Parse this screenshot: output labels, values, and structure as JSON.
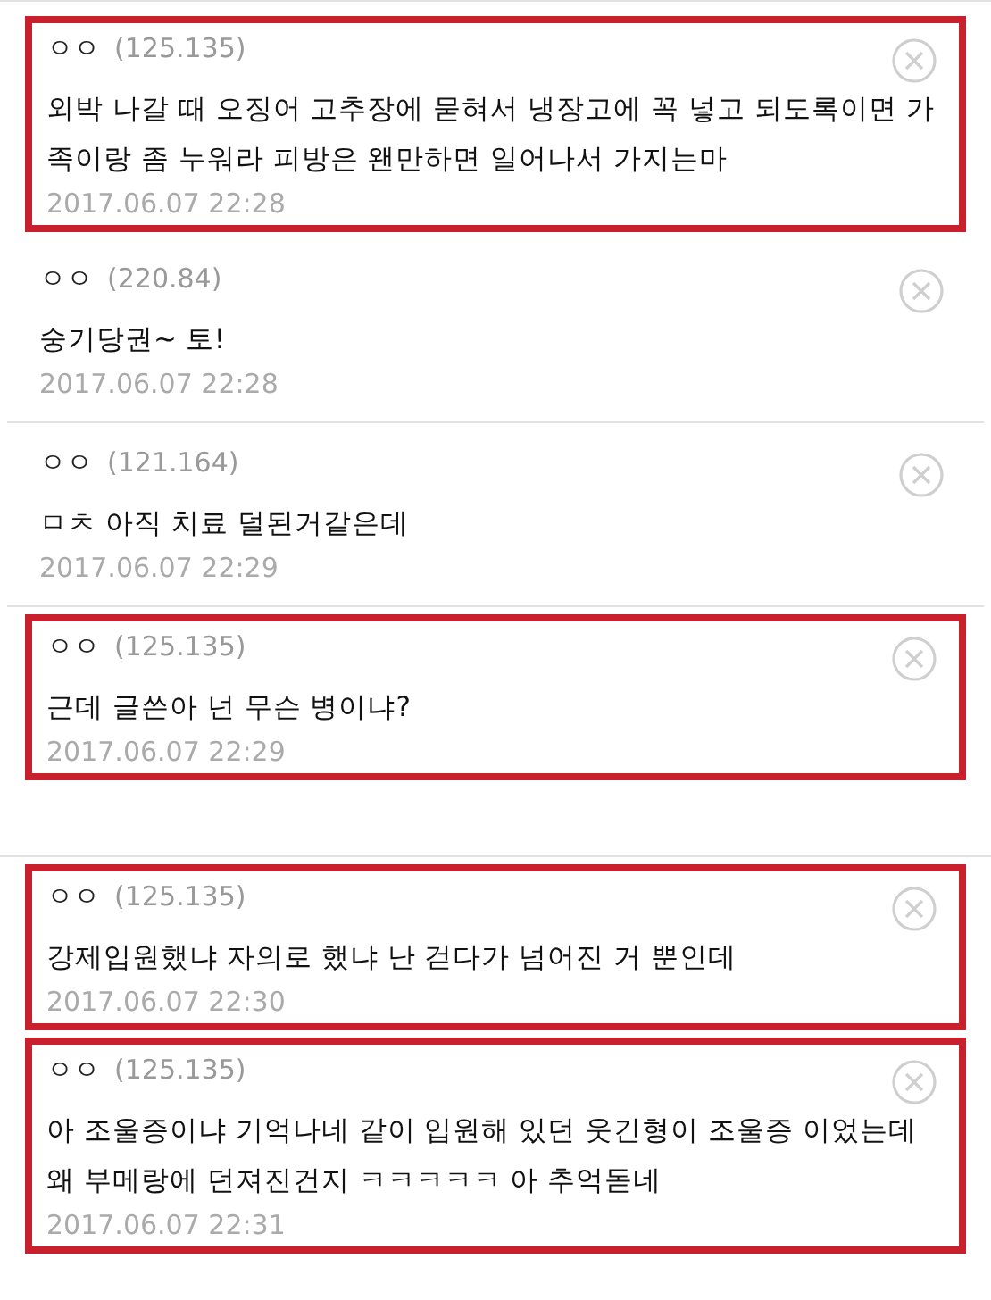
{
  "comment_groups": [
    [
      {
        "author": "ㅇㅇ",
        "ip": "(125.135)",
        "text": "외박 나갈 때 오징어 고추장에 묻혀서 냉장고에 꼭 넣고 되도록이면 가족이랑 좀 누워라 피방은 왠만하면 일어나서 가지는마",
        "date": "2017.06.07 22:28",
        "highlighted": true
      },
      {
        "author": "ㅇㅇ",
        "ip": "(220.84)",
        "text": "숭기당권~ 토!",
        "date": "2017.06.07 22:28",
        "highlighted": false
      },
      {
        "author": "ㅇㅇ",
        "ip": "(121.164)",
        "text": "ㅁㅊ 아직 치료 덜된거같은데",
        "date": "2017.06.07 22:29",
        "highlighted": false
      },
      {
        "author": "ㅇㅇ",
        "ip": "(125.135)",
        "text": "근데 글쓴아 넌 무슨 병이냐?",
        "date": "2017.06.07 22:29",
        "highlighted": true
      }
    ],
    [
      {
        "author": "ㅇㅇ",
        "ip": "(125.135)",
        "text": "강제입원했냐 자의로 했냐 난 걷다가 넘어진 거 뿐인데",
        "date": "2017.06.07 22:30",
        "highlighted": true
      },
      {
        "author": "ㅇㅇ",
        "ip": "(125.135)",
        "text": "아 조울증이냐 기억나네 같이 입원해 있던 웃긴형이 조울증 이었는데 왜 부메랑에 던져진건지 ㅋㅋㅋㅋㅋ 아 추억돋네",
        "date": "2017.06.07 22:31",
        "highlighted": true
      }
    ]
  ]
}
